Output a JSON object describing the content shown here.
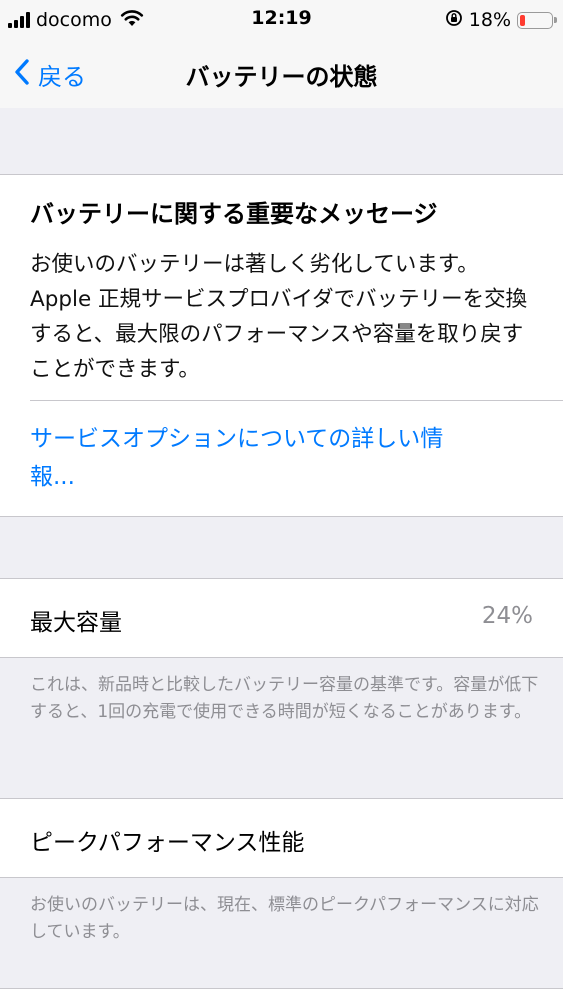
{
  "status_bar": {
    "carrier": "docomo",
    "time": "12:19",
    "battery_percent": "18%",
    "battery_level": 0.18,
    "icons": [
      "signal-icon",
      "wifi-icon",
      "orientation-lock-icon",
      "battery-icon"
    ]
  },
  "nav": {
    "back_label": "戻る",
    "title": "バッテリーの状態"
  },
  "message": {
    "title": "バッテリーに関する重要なメッセージ",
    "body": "お使いのバッテリーは著しく劣化しています。Apple 正規サービスプロバイダでバッテリーを交換すると、最大限のパフォーマンスや容量を取り戻すことができます。",
    "link": "サービスオプションについての詳しい情報..."
  },
  "capacity": {
    "label": "最大容量",
    "value": "24%",
    "note": "これは、新品時と比較したバッテリー容量の基準です。容量が低下すると、1回の充電で使用できる時間が短くなることがあります。"
  },
  "peak": {
    "label": "ピークパフォーマンス性能",
    "note": "お使いのバッテリーは、現在、標準のピークパフォーマンスに対応しています。"
  },
  "colors": {
    "accent": "#007aff",
    "battery_low": "#ff3b30",
    "secondary_text": "#8e8e93",
    "background": "#efeff4"
  }
}
